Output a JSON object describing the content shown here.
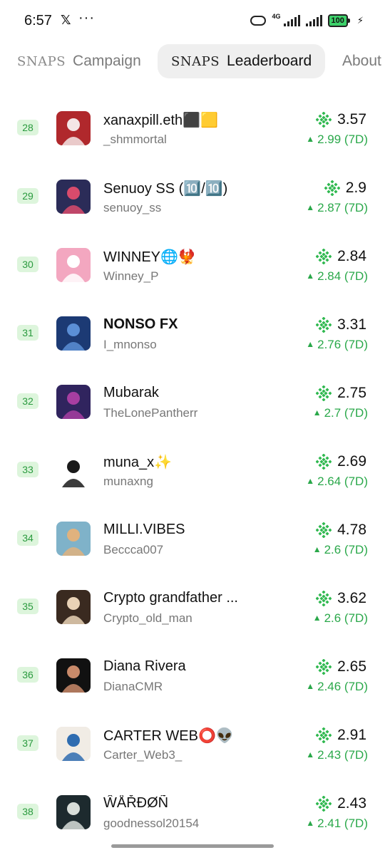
{
  "status_bar": {
    "time": "6:57",
    "x_icon": "𝕏",
    "dots": "···",
    "network": "4G",
    "battery": "100",
    "bolt": "⚡"
  },
  "tabs": [
    {
      "logo": "SNAPS",
      "label": "Campaign",
      "active": false
    },
    {
      "logo": "SNAPS",
      "label": "Leaderboard",
      "active": true
    },
    {
      "logo": "",
      "label": "About",
      "active": false
    }
  ],
  "colors": {
    "accent_green": "#2aa84a",
    "rank_bg": "#ddf5dc",
    "rank_text": "#2a9a3e"
  },
  "rows": [
    {
      "rank": "28",
      "name": "xanaxpill.eth⬛🟨",
      "handle": "_shmmortal",
      "score": "3.57",
      "change": "2.99 (7D)",
      "bold": false,
      "avatar_colors": [
        "#b0282c",
        "#f4e6e6"
      ]
    },
    {
      "rank": "29",
      "name": "Senuoy SS (🔟/🔟)",
      "handle": "senuoy_ss",
      "score": "2.9",
      "change": "2.87 (7D)",
      "bold": false,
      "avatar_colors": [
        "#2b2c58",
        "#d94b6c"
      ]
    },
    {
      "rank": "30",
      "name": "WINNEY🌐🐦‍🔥",
      "handle": "Winney_P",
      "score": "2.84",
      "change": "2.84 (7D)",
      "bold": false,
      "avatar_colors": [
        "#f3a7c0",
        "#ffffff"
      ]
    },
    {
      "rank": "31",
      "name": "NONSO FX",
      "handle": "I_mnonso",
      "score": "3.31",
      "change": "2.76 (7D)",
      "bold": true,
      "avatar_colors": [
        "#1c3a74",
        "#5b8fd6"
      ]
    },
    {
      "rank": "32",
      "name": "Mubarak",
      "handle": "TheLonePantherr",
      "score": "2.75",
      "change": "2.7 (7D)",
      "bold": false,
      "avatar_colors": [
        "#30245e",
        "#a73ea1"
      ]
    },
    {
      "rank": "33",
      "name": "muna_x✨",
      "handle": "munaxng",
      "score": "2.69",
      "change": "2.64 (7D)",
      "bold": false,
      "avatar_colors": [
        "#ffffff",
        "#1a1a1a"
      ]
    },
    {
      "rank": "34",
      "name": "MILLI.VIBES",
      "handle": "Beccca007",
      "score": "4.78",
      "change": "2.6 (7D)",
      "bold": false,
      "avatar_colors": [
        "#7fb2c9",
        "#e0b27e"
      ]
    },
    {
      "rank": "35",
      "name": "Crypto grandfather ...",
      "handle": "Crypto_old_man",
      "score": "3.62",
      "change": "2.6 (7D)",
      "bold": false,
      "avatar_colors": [
        "#3a2a20",
        "#e9d2b6"
      ]
    },
    {
      "rank": "36",
      "name": "Diana Rivera",
      "handle": "DianaCMR",
      "score": "2.65",
      "change": "2.46 (7D)",
      "bold": false,
      "avatar_colors": [
        "#111111",
        "#c98a6a"
      ]
    },
    {
      "rank": "37",
      "name": "CARTER WEB⭕👽",
      "handle": "Carter_Web3_",
      "score": "2.91",
      "change": "2.43 (7D)",
      "bold": false,
      "avatar_colors": [
        "#f1ece5",
        "#2f6cb0"
      ]
    },
    {
      "rank": "38",
      "name": "ŴÅŘĐØÑ",
      "handle": "goodnessol20154",
      "score": "2.43",
      "change": "2.41 (7D)",
      "bold": false,
      "avatar_colors": [
        "#1d2a2e",
        "#d8ded9"
      ]
    }
  ]
}
